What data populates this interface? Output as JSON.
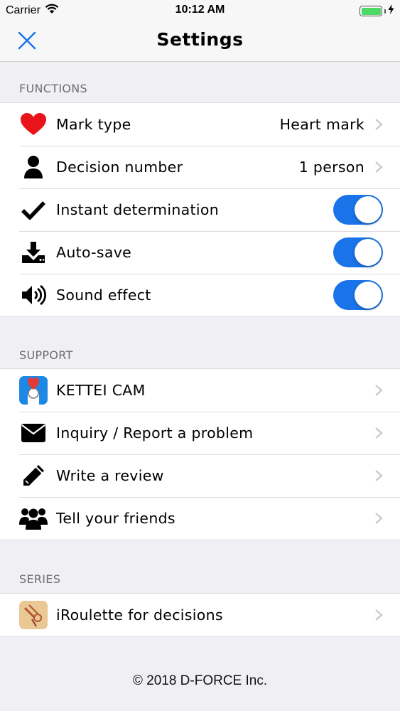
{
  "status_bar": {
    "carrier": "Carrier",
    "time": "10:12 AM",
    "battery_color": "#4cd964"
  },
  "nav": {
    "title": "Settings",
    "close_icon": "close-x-icon",
    "accent_color": "#1a73e8"
  },
  "functions": {
    "header": "FUNCTIONS",
    "items": [
      {
        "label": "Mark type",
        "value": "Heart mark",
        "icon": "heart-icon",
        "control": "disclosure"
      },
      {
        "label": "Decision number",
        "value": "1 person",
        "icon": "person-icon",
        "control": "disclosure"
      },
      {
        "label": "Instant determination",
        "icon": "checkmark-icon",
        "control": "toggle",
        "on": true
      },
      {
        "label": "Auto-save",
        "icon": "download-icon",
        "control": "toggle",
        "on": true
      },
      {
        "label": "Sound effect",
        "icon": "speaker-icon",
        "control": "toggle",
        "on": true
      }
    ]
  },
  "support": {
    "header": "SUPPORT",
    "items": [
      {
        "label": "KETTEI CAM",
        "icon": "kettei-cam-app-icon"
      },
      {
        "label": "Inquiry / Report a problem",
        "icon": "envelope-icon"
      },
      {
        "label": "Write a review",
        "icon": "pencil-icon"
      },
      {
        "label": "Tell your friends",
        "icon": "people-icon"
      }
    ]
  },
  "series": {
    "header": "SERIES",
    "items": [
      {
        "label": "iRoulette for decisions",
        "icon": "iroulette-app-icon"
      }
    ]
  },
  "footer": "© 2018 D-FORCE Inc."
}
